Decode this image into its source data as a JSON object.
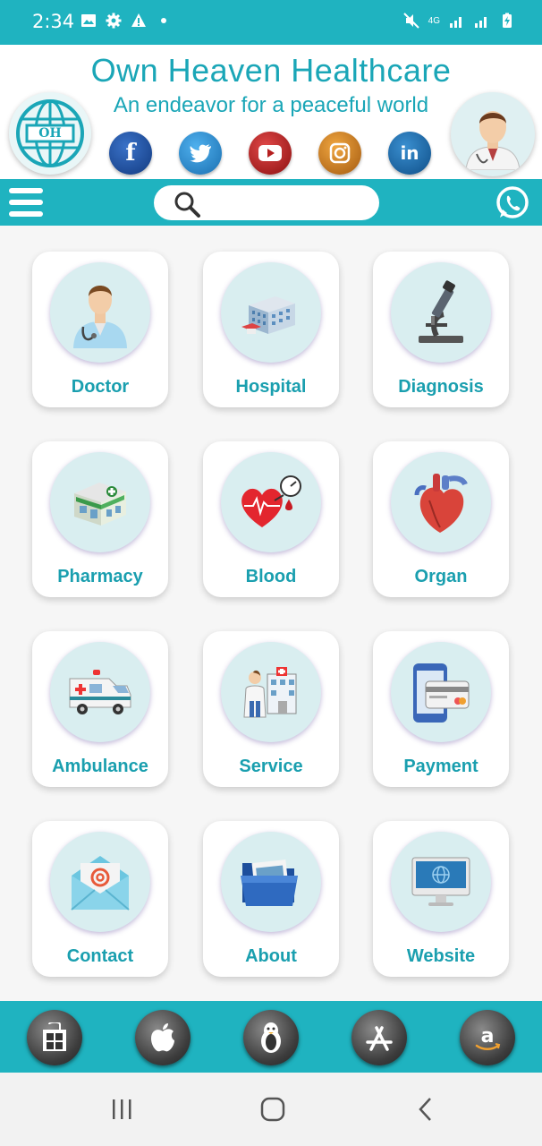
{
  "status_bar": {
    "time": "2:34",
    "network_label": "4G"
  },
  "header": {
    "title": "Own Heaven Healthcare",
    "tagline": "An endeavor for a peaceful world",
    "logo_text": "OH",
    "social": [
      {
        "name": "facebook",
        "glyph": "f",
        "color": "#1f4f9c"
      },
      {
        "name": "twitter",
        "glyph": "t",
        "color": "#2a86c8"
      },
      {
        "name": "youtube",
        "glyph": "▶",
        "color": "#b51f1f"
      },
      {
        "name": "instagram",
        "glyph": "◎",
        "color": "#c97a1a"
      },
      {
        "name": "linkedin",
        "glyph": "in",
        "color": "#1a6fb0"
      }
    ]
  },
  "toolbar": {
    "search_placeholder": ""
  },
  "grid": [
    {
      "label": "Doctor",
      "icon": "doctor-icon"
    },
    {
      "label": "Hospital",
      "icon": "hospital-icon"
    },
    {
      "label": "Diagnosis",
      "icon": "microscope-icon"
    },
    {
      "label": "Pharmacy",
      "icon": "pharmacy-icon"
    },
    {
      "label": "Blood",
      "icon": "blood-icon"
    },
    {
      "label": "Organ",
      "icon": "heart-organ-icon"
    },
    {
      "label": "Ambulance",
      "icon": "ambulance-icon"
    },
    {
      "label": "Service",
      "icon": "service-icon"
    },
    {
      "label": "Payment",
      "icon": "payment-icon"
    },
    {
      "label": "Contact",
      "icon": "mail-icon"
    },
    {
      "label": "About",
      "icon": "folder-icon"
    },
    {
      "label": "Website",
      "icon": "monitor-icon"
    }
  ],
  "app_stores": [
    "windows-icon",
    "apple-icon",
    "linux-icon",
    "app-store-icon",
    "amazon-icon"
  ],
  "colors": {
    "primary": "#1fb3c0",
    "label": "#1a9faf",
    "title": "#1aa6b7"
  }
}
